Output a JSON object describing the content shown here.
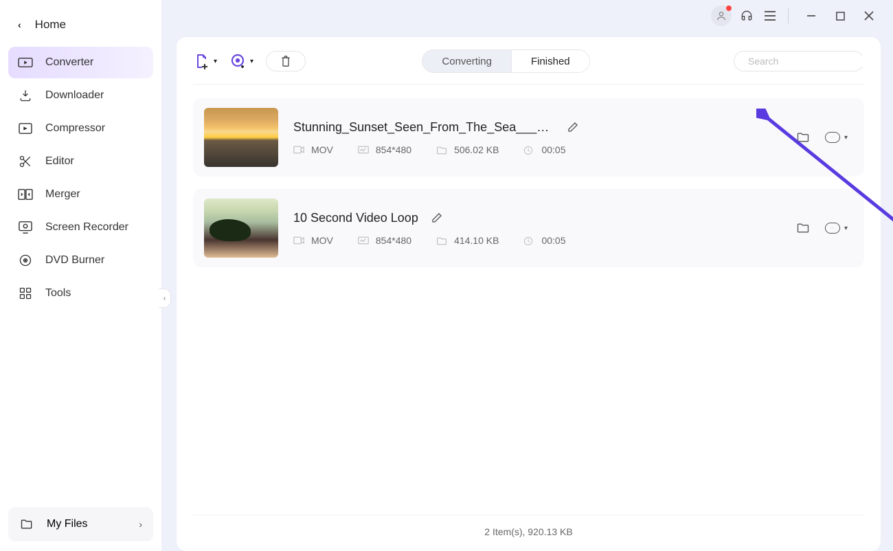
{
  "sidebar": {
    "home": "Home",
    "items": [
      {
        "label": "Converter"
      },
      {
        "label": "Downloader"
      },
      {
        "label": "Compressor"
      },
      {
        "label": "Editor"
      },
      {
        "label": "Merger"
      },
      {
        "label": "Screen Recorder"
      },
      {
        "label": "DVD Burner"
      },
      {
        "label": "Tools"
      }
    ],
    "my_files": "My Files"
  },
  "tabs": {
    "converting": "Converting",
    "finished": "Finished"
  },
  "search": {
    "placeholder": "Search"
  },
  "files": [
    {
      "title": "Stunning_Sunset_Seen_From_The_Sea___Ti...",
      "format": "MOV",
      "resolution": "854*480",
      "size": "506.02 KB",
      "duration": "00:05"
    },
    {
      "title": "10 Second Video Loop",
      "format": "MOV",
      "resolution": "854*480",
      "size": "414.10 KB",
      "duration": "00:05"
    }
  ],
  "footer": "2 Item(s), 920.13 KB"
}
